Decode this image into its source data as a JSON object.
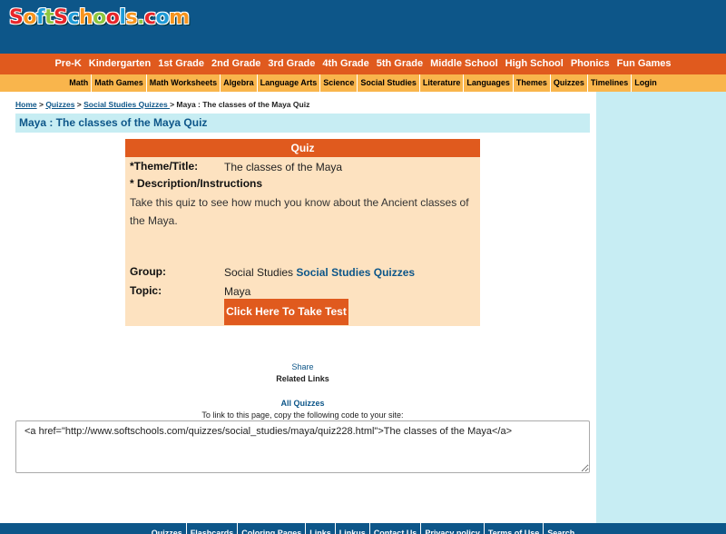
{
  "logo": {
    "letters": [
      "S",
      "o",
      "f",
      "t",
      "S",
      "c",
      "h",
      "o",
      "o",
      "l",
      "s",
      ".",
      "c",
      "o",
      "m"
    ],
    "colors": [
      "#e8262a",
      "#f7941d",
      "#1e9bd7",
      "#8dc63f",
      "#e8262a",
      "#1e9bd7",
      "#f7941d",
      "#8dc63f",
      "#e8262a",
      "#1e9bd7",
      "#f7941d",
      "#8dc63f",
      "#e8262a",
      "#1e9bd7",
      "#f7941d"
    ]
  },
  "nav_primary": [
    "Pre-K",
    "Kindergarten",
    "1st Grade",
    "2nd Grade",
    "3rd Grade",
    "4th Grade",
    "5th Grade",
    "Middle School",
    "High School",
    "Phonics",
    "Fun Games"
  ],
  "nav_secondary": [
    "Math",
    "Math Games",
    "Math Worksheets",
    "Algebra",
    "Language Arts",
    "Science",
    "Social Studies",
    "Literature",
    "Languages",
    "Themes",
    "Quizzes",
    "Timelines",
    "Login"
  ],
  "breadcrumb": {
    "home": "Home",
    "sep": " > ",
    "quizzes": "Quizzes",
    "social": "Social Studies Quizzes ",
    "current": " > Maya : The classes of the Maya Quiz"
  },
  "page_title": "Maya : The classes of the Maya Quiz",
  "quiz": {
    "header": "Quiz",
    "theme_label": "*Theme/Title:",
    "theme_value": "The classes of the Maya",
    "desc_label": "* Description/Instructions",
    "desc_text": "Take this quiz to see how much you know about the Ancient classes of the Maya.",
    "group_label": "Group:",
    "group_value": "Social Studies",
    "group_link": "Social Studies Quizzes",
    "topic_label": "Topic:",
    "topic_value": "Maya",
    "take_test": "Click Here To Take Test"
  },
  "share": "Share",
  "related_links": "Related Links",
  "all_quizzes": "All Quizzes",
  "link_instructions": "To link to this page, copy the following code to your site:",
  "link_code": "<a href=\"http://www.softschools.com/quizzes/social_studies/maya/quiz228.html\">The classes of the Maya</a>",
  "footer": [
    "Quizzes",
    "Flashcards",
    "Coloring Pages",
    "Links",
    "Linkus",
    "Contact Us",
    "Privacy policy",
    "Terms of Use",
    "Search"
  ],
  "colors": {
    "header_blue": "#0d5689",
    "nav_orange": "#e05a1e",
    "subnav_gold": "#f9b54c",
    "quiz_bg": "#fde2c0",
    "sidebar_cyan": "#c7edf3"
  }
}
